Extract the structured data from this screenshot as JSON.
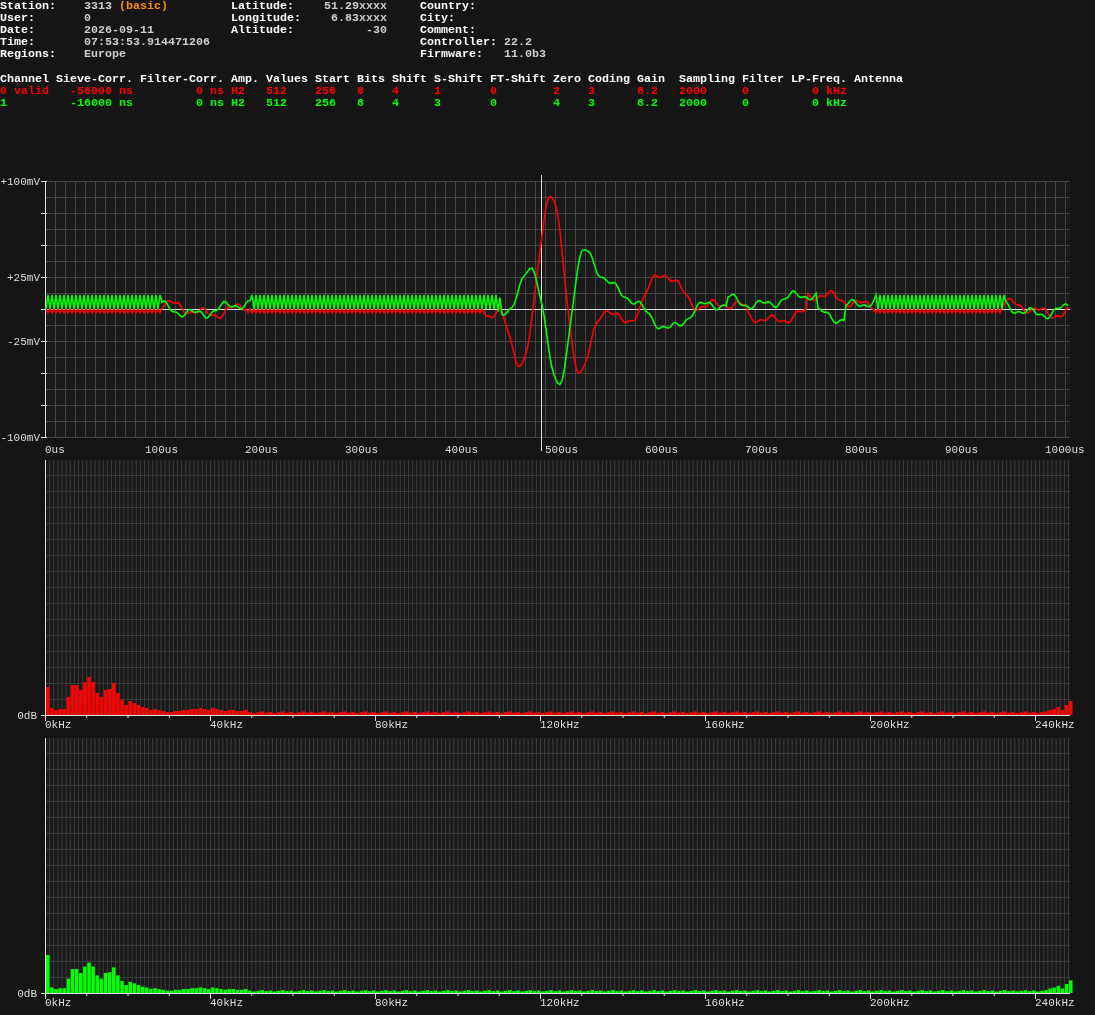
{
  "info_columns": [
    [
      {
        "label": "Station:",
        "value": "3313",
        "note": "(basic)"
      },
      {
        "label": "User:",
        "value": "0"
      },
      {
        "label": "Date:",
        "value": "2026-09-11"
      },
      {
        "label": "Time:",
        "value": "07:53:53.914471206"
      },
      {
        "label": "Regions:",
        "value": "Europe"
      }
    ],
    [
      {
        "label": "Latitude:",
        "value": "51.29xxxx"
      },
      {
        "label": "Longitude:",
        "value": "6.83xxxx"
      },
      {
        "label": "Altitude:",
        "value": "-30"
      }
    ],
    [
      {
        "label": "Country:"
      },
      {
        "label": "City:"
      },
      {
        "label": "Comment:"
      },
      {
        "label": "Controller:",
        "value": "22.2"
      },
      {
        "label": "Firmware:",
        "value": "11.0b3"
      }
    ]
  ],
  "channels": {
    "columns": [
      "Channel",
      "Sieve-Corr.",
      "Filter-Corr.",
      "Amp.",
      "Values",
      "Start",
      "Bits",
      "Shift",
      "S-Shift",
      "FT-Shift",
      "Zero",
      "Coding",
      "Gain",
      "Sampling",
      "Filter",
      "LP-Freq.",
      "Antenna"
    ],
    "rows": [
      {
        "color": "#ff0000",
        "cells": [
          "0 valid",
          "-56000 ns",
          "0 ns",
          "H2",
          "512",
          "256",
          "8",
          "4",
          "1",
          "0",
          "2",
          "3",
          "8.2",
          "2000",
          "0",
          "0 kHz"
        ]
      },
      {
        "color": "#00ff00",
        "cells": [
          "1",
          "-16000 ns",
          "0 ns",
          "H2",
          "512",
          "256",
          "8",
          "4",
          "3",
          "0",
          "4",
          "3",
          "8.2",
          "2000",
          "0",
          "0 kHz"
        ]
      }
    ]
  },
  "waveform": {
    "y_labels": [
      "+100mV",
      "+25mV",
      "-25mV",
      "-100mV"
    ],
    "x_labels": [
      "0us",
      "100us",
      "200us",
      "300us",
      "400us",
      "500us",
      "600us",
      "700us",
      "800us",
      "900us",
      "1000us"
    ]
  },
  "spectra": [
    {
      "color": "#ff0000",
      "y_label": "0dB",
      "x_labels": [
        "0kHz",
        "40kHz",
        "80kHz",
        "120kHz",
        "160kHz",
        "200kHz",
        "240kHz"
      ]
    },
    {
      "color": "#00ff00",
      "y_label": "0dB",
      "x_labels": [
        "0kHz",
        "40kHz",
        "80kHz",
        "120kHz",
        "160kHz",
        "200kHz",
        "240kHz"
      ]
    }
  ]
}
